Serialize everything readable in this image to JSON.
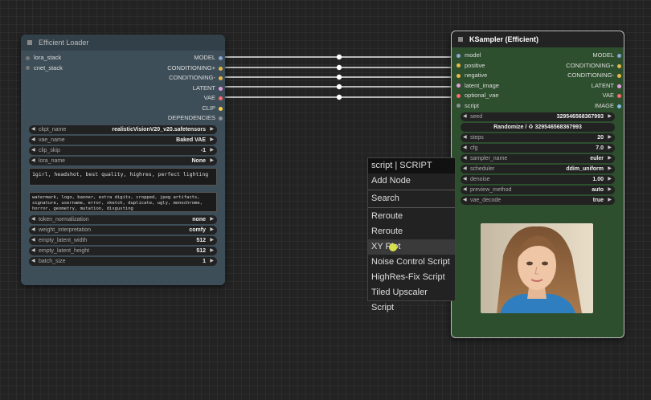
{
  "loader": {
    "title": "Efficient Loader",
    "inputs": [
      "lora_stack",
      "cnet_stack"
    ],
    "outputs": [
      {
        "label": "MODEL",
        "color": "#8aa6d6"
      },
      {
        "label": "CONDITIONING+",
        "color": "#e8b94a"
      },
      {
        "label": "CONDITIONING-",
        "color": "#e8b94a"
      },
      {
        "label": "LATENT",
        "color": "#e79ee3"
      },
      {
        "label": "VAE",
        "color": "#ff6b6b"
      },
      {
        "label": "CLIP",
        "color": "#ffd24a"
      },
      {
        "label": "DEPENDENCIES",
        "color": "#8a8f94"
      }
    ],
    "widgets1": [
      {
        "label": "ckpt_name",
        "value": "realisticVisionV20_v20.safetensors"
      },
      {
        "label": "vae_name",
        "value": "Baked VAE"
      },
      {
        "label": "clip_skip",
        "value": "-1"
      },
      {
        "label": "lora_name",
        "value": "None"
      }
    ],
    "positive_prompt": "1girl, headshot, best quality, highres, perfect lighting",
    "negative_prompt": "watermark, logo, banner, extra digits, cropped, jpeg artifacts, signature, username, error, sketch, duplicate, ugly, monochrome, horror, geometry, mutation, disgusting",
    "widgets2": [
      {
        "label": "token_normalization",
        "value": "none"
      },
      {
        "label": "weight_interpretation",
        "value": "comfy"
      },
      {
        "label": "empty_latent_width",
        "value": "512"
      },
      {
        "label": "empty_latent_height",
        "value": "512"
      },
      {
        "label": "batch_size",
        "value": "1"
      }
    ]
  },
  "ksampler": {
    "title": "KSampler (Efficient)",
    "slots": [
      {
        "in": "model",
        "out": "MODEL",
        "color": "#8aa6d6"
      },
      {
        "in": "positive",
        "out": "CONDITIONING+",
        "color": "#e8b94a"
      },
      {
        "in": "negative",
        "out": "CONDITIONING-",
        "color": "#e8b94a"
      },
      {
        "in": "latent_image",
        "out": "LATENT",
        "color": "#e79ee3"
      },
      {
        "in": "optional_vae",
        "out": "VAE",
        "color": "#ff6b6b"
      },
      {
        "in": "script",
        "out": "IMAGE",
        "color": "#7fbde0"
      }
    ],
    "seed": {
      "label": "seed",
      "value": "329546568367993"
    },
    "randomize_label": "Randomize / ♻ 329546568367993",
    "widgets": [
      {
        "label": "steps",
        "value": "20"
      },
      {
        "label": "cfg",
        "value": "7.0"
      },
      {
        "label": "sampler_name",
        "value": "euler"
      },
      {
        "label": "scheduler",
        "value": "ddim_uniform"
      },
      {
        "label": "denoise",
        "value": "1.00"
      },
      {
        "label": "preview_method",
        "value": "auto"
      },
      {
        "label": "vae_decode",
        "value": "true"
      }
    ]
  },
  "context_menu": {
    "title": "script | SCRIPT",
    "items": [
      "Add Node",
      "Search",
      "Reroute",
      "Reroute",
      "XY Plot",
      "Noise Control Script",
      "HighRes-Fix Script",
      "Tiled Upscaler Script"
    ]
  },
  "colors": {
    "wire": "#e8e8e8",
    "canvas": "#232323",
    "loader_bg": "#3e4e58",
    "ksampler_bg": "#2e4f2e"
  }
}
